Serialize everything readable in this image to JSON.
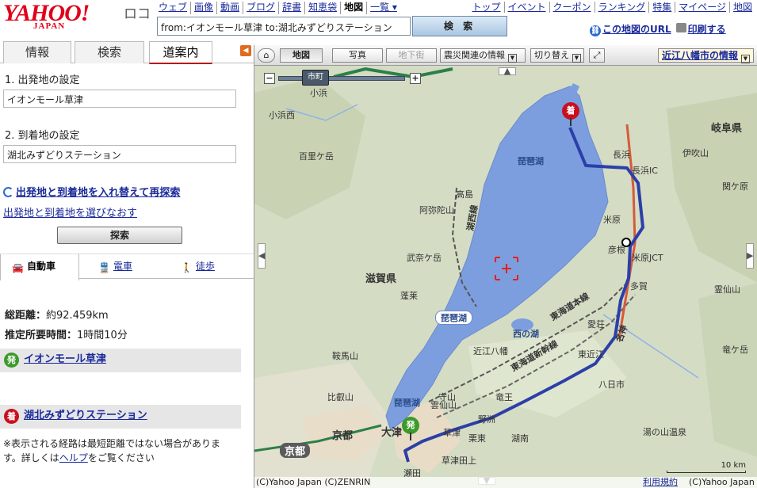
{
  "header": {
    "logo_text": "YAHOO!",
    "logo_sub": "JAPAN",
    "logo_loco": "ロコ",
    "services": [
      "ウェブ",
      "画像",
      "動画",
      "ブログ",
      "辞書",
      "知恵袋",
      "地図",
      "一覧 ▾"
    ],
    "current_service": "地図",
    "top_links": [
      "トップ",
      "イベント",
      "クーポン",
      "ランキング",
      "特集",
      "マイページ",
      "地図"
    ],
    "search_value": "from:イオンモール草津 to:湖北みずどりステーション",
    "search_button": "検 索",
    "map_url_link": "この地図のURL",
    "print_link": "印刷する"
  },
  "sidebar": {
    "tabs": [
      "情報",
      "検索",
      "道案内"
    ],
    "active_tab": "道案内",
    "start_label": "1. 出発地の設定",
    "start_value": "イオンモール草津",
    "end_label": "2. 到着地の設定",
    "end_value": "湖北みずどりステーション",
    "swap_link": "出発地と到着地を入れ替えて再探索",
    "reselect_link": "出発地と到着地を選びなおす",
    "search_button": "探索",
    "modes": [
      "自動車",
      "電車",
      "徒歩"
    ],
    "active_mode": "自動車",
    "distance_label": "総距離：",
    "distance_value": "約92.459km",
    "time_label": "推定所要時間：",
    "time_value": "1時間10分",
    "start_badge": "発",
    "start_point": "イオンモール草津",
    "end_badge": "着",
    "end_point": "湖北みずどりステーション",
    "note_line1": "※表示される経路は最短距離ではない場合がありま",
    "note_line2_a": "す。詳しくは",
    "note_line2_link": "ヘルプ",
    "note_line2_b": "をご覧ください"
  },
  "map": {
    "toolbar": {
      "map_btn": "地図",
      "photo_btn": "写真",
      "underground_btn": "地下街",
      "disaster_select": "震災関連の情報",
      "switch_select": "切り替え"
    },
    "city_info": "近江八幡市の情報",
    "zoom_label": "市町",
    "lake_labels": [
      "琵琶湖",
      "琵琶湖",
      "西の湖",
      "琵琶湖"
    ],
    "region_labels": [
      "滋賀県",
      "岐阜県",
      "京都"
    ],
    "place_labels": [
      "小浜",
      "小浜西",
      "百里ケ岳",
      "高島",
      "阿弥陀山",
      "武奈ケ岳",
      "蓬莱",
      "彦根",
      "米原",
      "長浜",
      "伊吹山",
      "多賀",
      "愛荘",
      "近江八幡",
      "東近江",
      "竜王",
      "野洲",
      "守山",
      "草津",
      "大津",
      "京都",
      "湖南",
      "八日市",
      "雲仙山",
      "鞍馬山",
      "比叡山",
      "栗東",
      "草津田上",
      "瀬田",
      "湯の山温泉",
      "竜ケ岳",
      "霊仙山",
      "関ケ原",
      "米原JCT",
      "長浜IC"
    ],
    "road_labels": [
      "湖西線",
      "東海道本線",
      "東海道新幹線",
      "名神"
    ],
    "scale_label": "10 km",
    "copyright_left": "(C)Yahoo Japan (C)ZENRIN",
    "copyright_right": "(C)Yahoo Japan",
    "terms_link": "利用規約",
    "end_pin": "着",
    "start_pin": "発"
  },
  "colors": {
    "route": "#2c3fa8",
    "lake": "#7d9ede",
    "accent_red": "#c8101e",
    "start_green": "#3c9a2a"
  }
}
